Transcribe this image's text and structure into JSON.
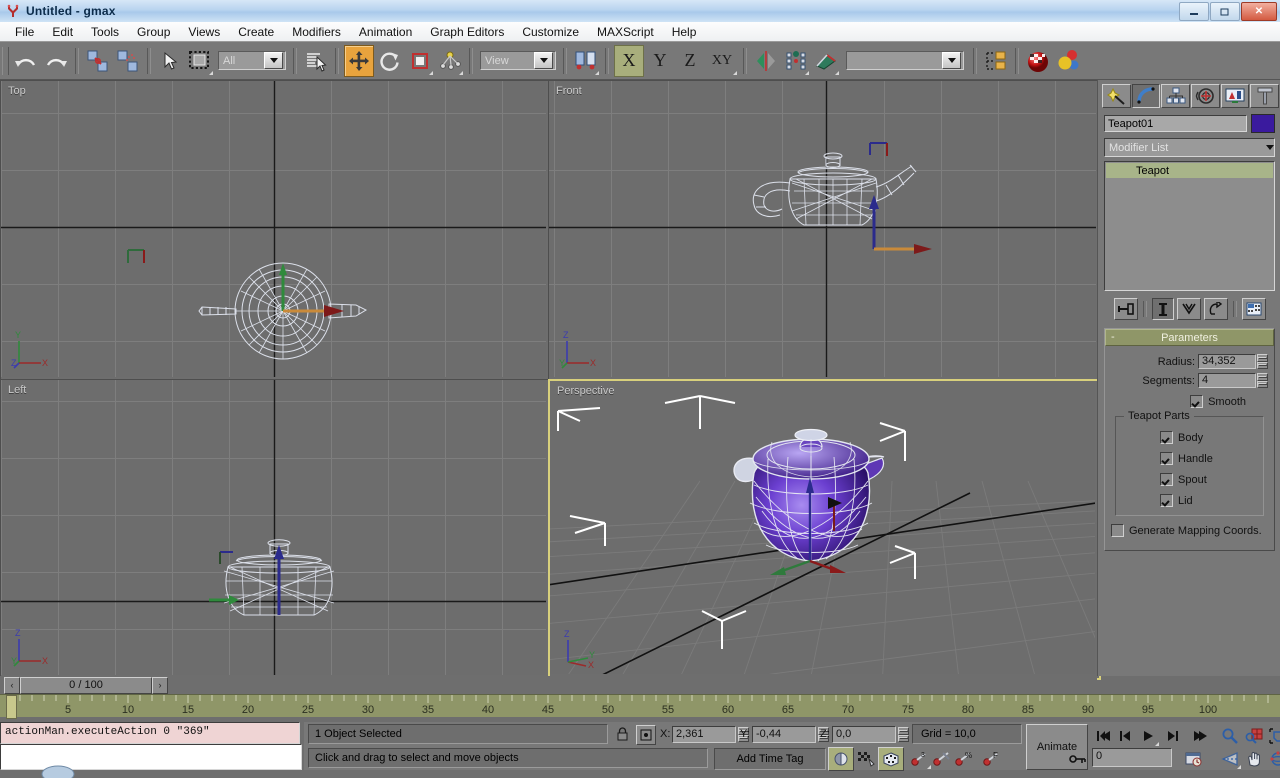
{
  "window": {
    "title": "Untitled - gmax",
    "app_icon": "gmax-logo-icon",
    "minimize": "minimize-icon",
    "restore": "restore-icon",
    "close": "close-icon"
  },
  "menu": {
    "items": [
      "File",
      "Edit",
      "Tools",
      "Group",
      "Views",
      "Create",
      "Modifiers",
      "Animation",
      "Graph Editors",
      "Customize",
      "MAXScript",
      "Help"
    ]
  },
  "toolbar": {
    "undo": "undo-icon",
    "redo": "redo-icon",
    "select_link": "select-and-link-icon",
    "unlink": "unlink-selection-icon",
    "select_object": "select-object-arrow-icon",
    "select_region": "select-region-rectangle-icon",
    "selection_filter": "All",
    "select_by_name": "select-by-name-icon",
    "select_move": "select-and-move-icon",
    "select_rotate": "select-and-rotate-icon",
    "select_scale": "select-and-scale-icon",
    "use_center": "use-pivot-point-center-icon",
    "ref_coord_system": "View",
    "mirror": "mirror-icon",
    "align": "align-icon",
    "axis_x": "X",
    "axis_y": "Y",
    "axis_z": "Z",
    "axis_xy": "XY",
    "named_selection_sets": "",
    "snap_toggle": "snaps-toggle-icon",
    "angle_snap": "angle-snap-icon",
    "percent_snap": "percent-snap-icon",
    "material_editor": "material-editor-icon",
    "material_nav": "material-navigator-icon"
  },
  "viewports": [
    {
      "label": "Top",
      "active": false,
      "gizmo": [
        "Y",
        "Z",
        "X"
      ]
    },
    {
      "label": "Front",
      "active": false,
      "gizmo": [
        "Z",
        "Y",
        "X"
      ]
    },
    {
      "label": "Left",
      "active": false,
      "gizmo": [
        "Z",
        "Y",
        "X"
      ]
    },
    {
      "label": "Perspective",
      "active": true,
      "gizmo": [
        "Z",
        "Y",
        "X"
      ]
    }
  ],
  "command_panel": {
    "tabs": [
      "create-tab-icon",
      "modify-tab-icon",
      "hierarchy-tab-icon",
      "motion-tab-icon",
      "display-tab-icon",
      "utilities-tab-icon"
    ],
    "selected_tab_index": 1,
    "object_name": "Teapot01",
    "object_color": "#3a1a9e",
    "modifier_list_label": "Modifier List",
    "modifier_stack": [
      "Teapot"
    ],
    "stack_buttons": [
      "pin-stack-icon",
      "show-end-result-icon",
      "make-unique-icon",
      "remove-modifier-icon",
      "configure-modifier-sets-icon"
    ],
    "rollout": {
      "title": "Parameters",
      "collapse_glyph": "-",
      "params": [
        {
          "label": "Radius:",
          "value": "34,352"
        },
        {
          "label": "Segments:",
          "value": "4"
        }
      ],
      "smooth": {
        "label": "Smooth",
        "checked": true
      },
      "teapot_parts": {
        "title": "Teapot Parts",
        "items": [
          {
            "label": "Body",
            "checked": true
          },
          {
            "label": "Handle",
            "checked": true
          },
          {
            "label": "Spout",
            "checked": true
          },
          {
            "label": "Lid",
            "checked": true
          }
        ]
      },
      "generate_mapping": {
        "label": "Generate Mapping Coords.",
        "checked": false
      }
    }
  },
  "timeline": {
    "prev_glyph": "‹",
    "next_glyph": "›",
    "current_frame": "0 / 100",
    "ticks": [
      "5",
      "10",
      "15",
      "20",
      "25",
      "30",
      "35",
      "40",
      "45",
      "50",
      "55",
      "60",
      "65",
      "70",
      "75",
      "80",
      "85",
      "90",
      "95",
      "100"
    ]
  },
  "listener": {
    "output": "actionMan.executeAction 0 \"369\"",
    "input": ""
  },
  "status": {
    "selection": "1 Object Selected",
    "prompt": "Click and drag to select and move objects",
    "lock_icon": "selection-lock-icon",
    "absolute_mode_icon": "absolute-relative-transform-icon",
    "coords": [
      {
        "axis": "X:",
        "value": "2,361"
      },
      {
        "axis": "Y:",
        "value": "-0,44"
      },
      {
        "axis": "Z:",
        "value": "0,0"
      }
    ],
    "grid": "Grid = 10,0",
    "add_time_tag": "Add Time Tag",
    "animate": "Animate",
    "key_filters": [
      "auto-key-icon",
      "set-key-icon",
      "key-mode-icon"
    ],
    "render_icons": [
      "quick-render-icon",
      "render-scene-icon",
      "render-type-icon"
    ],
    "misc_icons": [
      "key-3-icon",
      "key-filter-icon",
      "key-percent-icon",
      "key-f-icon"
    ],
    "time_field": "0",
    "key_toggle_icon": "key-toggle-icon",
    "timeconfig_icon": "time-configuration-icon",
    "playback": [
      "go-to-start-icon",
      "previous-frame-icon",
      "play-animation-icon",
      "next-frame-icon",
      "go-to-end-icon"
    ],
    "nav": [
      "zoom-icon",
      "zoom-all-icon",
      "zoom-extents-icon",
      "zoom-extents-all-icon",
      "field-of-view-icon",
      "pan-icon",
      "arc-rotate-icon",
      "min-max-toggle-icon"
    ]
  },
  "scene": {
    "object": "Teapot01",
    "shaded_color_top": "#9a7ae8",
    "shaded_color_bottom": "#2d1270",
    "wire_color": "#d9dce8"
  }
}
